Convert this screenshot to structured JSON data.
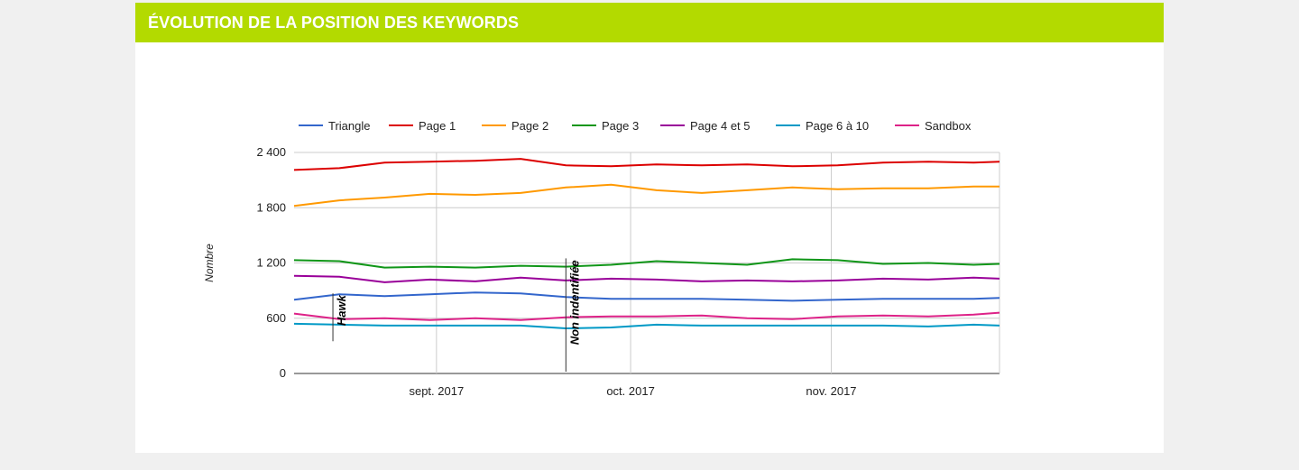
{
  "header": {
    "title": "ÉVOLUTION DE LA POSITION DES KEYWORDS"
  },
  "colors": {
    "header_bg": "#b3da00",
    "header_text": "#ffffff"
  },
  "chart_data": {
    "type": "line",
    "title": "",
    "ylabel": "Nombre",
    "xlabel": "",
    "ylim": [
      0,
      2400
    ],
    "yticks": [
      0,
      600,
      1200,
      1800,
      2400
    ],
    "ytick_labels": [
      "0",
      "600",
      "1 200",
      "1 800",
      "2 400"
    ],
    "xlim": [
      "2017-08-10",
      "2017-11-27"
    ],
    "xticks": [
      {
        "date": "2017-09-01",
        "label": "sept. 2017"
      },
      {
        "date": "2017-10-01",
        "label": "oct. 2017"
      },
      {
        "date": "2017-11-01",
        "label": "nov. 2017"
      }
    ],
    "grid": true,
    "legend_position": "top",
    "annotations": [
      {
        "date": "2017-08-16",
        "label": "Hawk"
      },
      {
        "date": "2017-09-21",
        "label": "Non indentifiée"
      }
    ],
    "x": [
      "2017-08-10",
      "2017-08-17",
      "2017-08-24",
      "2017-08-31",
      "2017-09-07",
      "2017-09-14",
      "2017-09-21",
      "2017-09-28",
      "2017-10-05",
      "2017-10-12",
      "2017-10-19",
      "2017-10-26",
      "2017-11-02",
      "2017-11-09",
      "2017-11-16",
      "2017-11-23",
      "2017-11-27"
    ],
    "series": [
      {
        "name": "Triangle",
        "color": "#3366cc",
        "values": [
          800,
          860,
          840,
          860,
          880,
          870,
          830,
          810,
          810,
          810,
          800,
          790,
          800,
          810,
          810,
          810,
          820
        ]
      },
      {
        "name": "Page 1",
        "color": "#dc0000",
        "values": [
          2210,
          2230,
          2290,
          2300,
          2310,
          2330,
          2260,
          2250,
          2270,
          2260,
          2270,
          2250,
          2260,
          2290,
          2300,
          2290,
          2300
        ]
      },
      {
        "name": "Page 2",
        "color": "#ff9900",
        "values": [
          1820,
          1880,
          1910,
          1950,
          1940,
          1960,
          2020,
          2050,
          1990,
          1960,
          1990,
          2020,
          2000,
          2010,
          2010,
          2030,
          2030
        ]
      },
      {
        "name": "Page 3",
        "color": "#109618",
        "values": [
          1230,
          1220,
          1150,
          1160,
          1150,
          1170,
          1160,
          1180,
          1220,
          1200,
          1180,
          1240,
          1230,
          1190,
          1200,
          1180,
          1190
        ]
      },
      {
        "name": "Page 4 et 5",
        "color": "#990099",
        "values": [
          1060,
          1050,
          990,
          1020,
          1000,
          1040,
          1010,
          1030,
          1020,
          1000,
          1010,
          1000,
          1010,
          1030,
          1020,
          1040,
          1030
        ]
      },
      {
        "name": "Page 6 à 10",
        "color": "#0099c6",
        "values": [
          540,
          530,
          520,
          520,
          520,
          520,
          490,
          500,
          530,
          520,
          520,
          520,
          520,
          520,
          510,
          530,
          520
        ]
      },
      {
        "name": "Sandbox",
        "color": "#dd2288",
        "values": [
          650,
          590,
          600,
          580,
          600,
          580,
          610,
          620,
          620,
          630,
          600,
          590,
          620,
          630,
          620,
          640,
          660
        ]
      }
    ]
  }
}
